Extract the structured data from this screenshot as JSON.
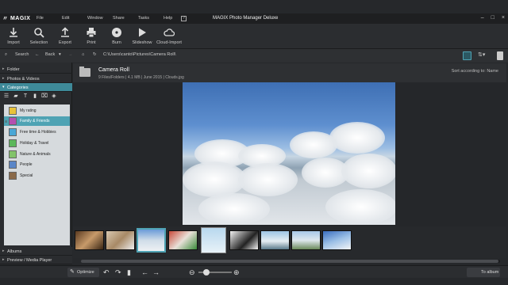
{
  "app": {
    "logo": "MAGIX",
    "title": "MAGIX Photo Manager Deluxe",
    "menu": [
      "File",
      "Edit",
      "Window",
      "Share",
      "Tasks",
      "Help"
    ],
    "menu_extra": "?"
  },
  "toolbar": [
    {
      "label": "Import",
      "icon": "download-icon"
    },
    {
      "label": "Selection",
      "icon": "search-icon"
    },
    {
      "label": "Export",
      "icon": "upload-icon"
    },
    {
      "label": "Print",
      "icon": "printer-icon"
    },
    {
      "label": "Burn",
      "icon": "disc-icon"
    },
    {
      "label": "Slideshow",
      "icon": "play-icon"
    },
    {
      "label": "Cloud-Import",
      "icon": "cloud-icon"
    }
  ],
  "nav": {
    "search_label": "Search",
    "back_label": "Back",
    "path": "C:\\Users\\canto\\Pictures\\Camera Roll\\"
  },
  "sidebar": {
    "sections": [
      "Folder",
      "Photos & Videos",
      "Categories",
      "Albums",
      "Preview / Media Player"
    ],
    "categories": [
      {
        "label": "My rating",
        "color": "#e8c23a"
      },
      {
        "label": "Family & Friends",
        "color": "#b44fb0"
      },
      {
        "label": "Free time & Hobbies",
        "color": "#4aa7d6"
      },
      {
        "label": "Holiday & Travel",
        "color": "#5cb85c"
      },
      {
        "label": "Nature & Animals",
        "color": "#82c36a"
      },
      {
        "label": "People",
        "color": "#5a86c8"
      },
      {
        "label": "Special",
        "color": "#8a6a4a"
      }
    ],
    "selected_category": 1
  },
  "header": {
    "title": "Camera Roll",
    "info": "9 Files/Folders | 4.1 MB | June 2015 | Clouds.jpg",
    "sort": "Sort according to: Name"
  },
  "bottom": {
    "optimize_label": "Optimize",
    "to_album_label": "To album"
  },
  "colors": {
    "accent": "#4fa3b4",
    "background": "#26282b"
  }
}
